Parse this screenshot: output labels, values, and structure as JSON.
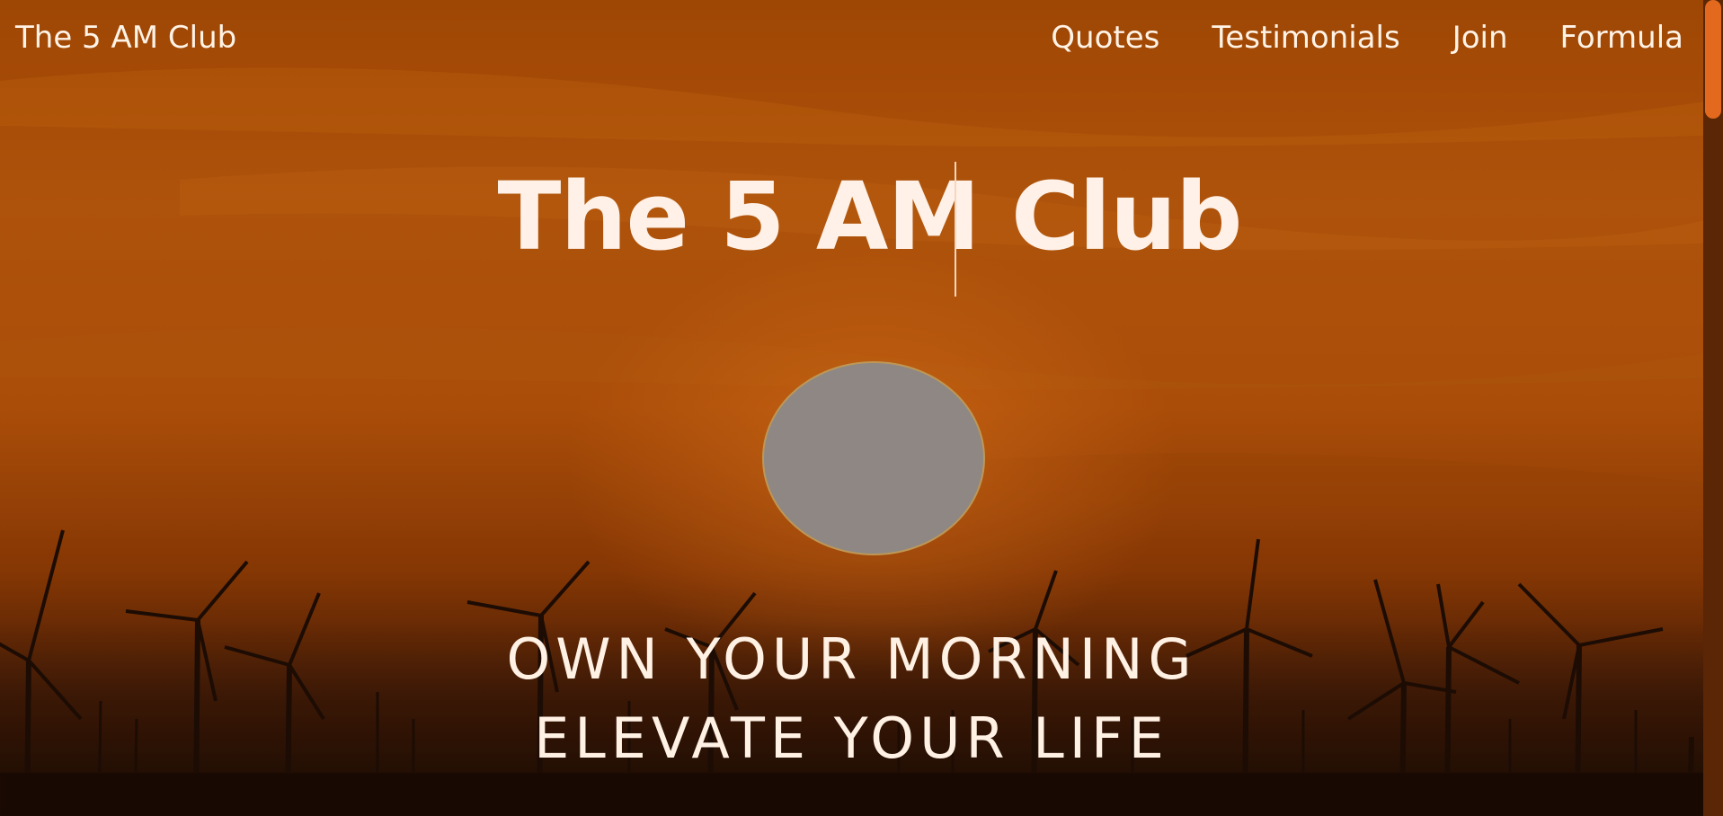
{
  "nav": {
    "brand": "The 5 AM Club",
    "links": [
      {
        "label": "Quotes"
      },
      {
        "label": "Testimonials"
      },
      {
        "label": "Join"
      },
      {
        "label": "Formula"
      }
    ]
  },
  "hero": {
    "title": "The 5 AM Club",
    "tagline_line1": "OWN YOUR MORNING",
    "tagline_line2": "ELEVATE YOUR LIFE"
  },
  "colors": {
    "accent": "#e2691d",
    "sky_top": "#a84a06",
    "sky_mid": "#c65a0c",
    "text_light": "#fff1e7"
  }
}
